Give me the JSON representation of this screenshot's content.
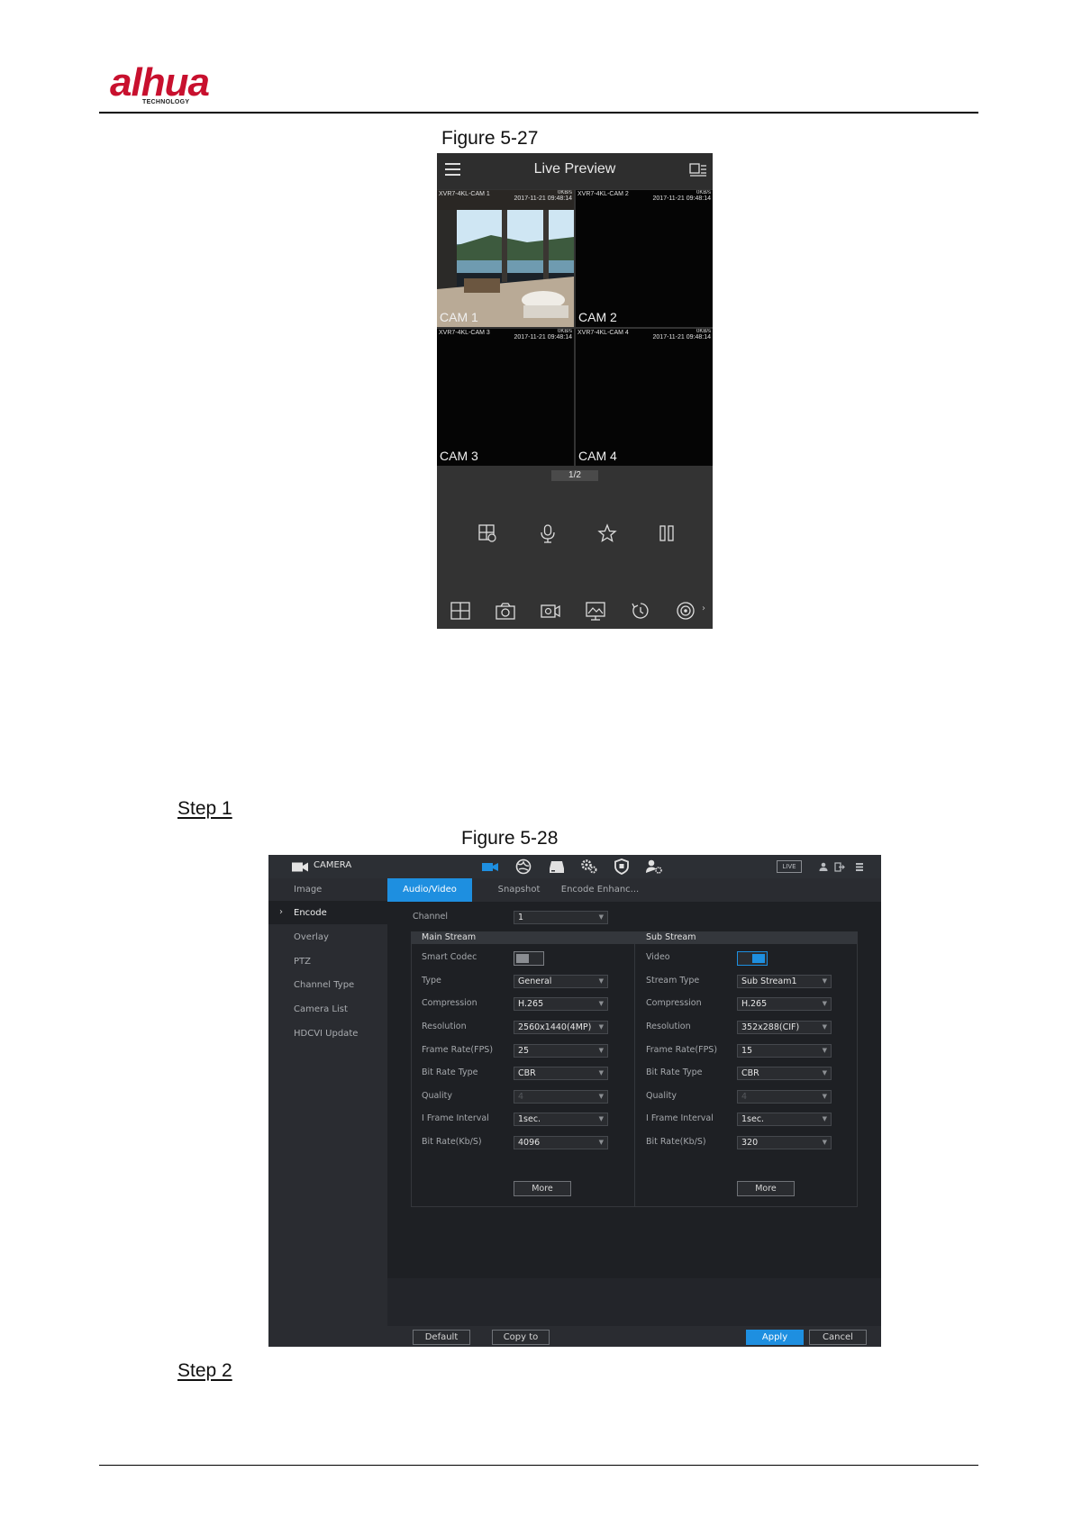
{
  "document": {
    "logo_text": "alhua",
    "logo_sub": "TECHNOLOGY",
    "figure1_caption": "Figure 5-27",
    "figure2_caption": "Figure 5-28",
    "step1": "Step 1",
    "step2": "Step 2"
  },
  "phone": {
    "title": "Live Preview",
    "page_indicator": "1/2",
    "cells": [
      {
        "osd_name": "XVR7-4KL-CAM 1",
        "osd_time": "2017-11-21 09:48:14",
        "osd_rate": "0KB/s",
        "label": "CAM 1"
      },
      {
        "osd_name": "XVR7-4KL-CAM 2",
        "osd_time": "2017-11-21 09:48:14",
        "osd_rate": "0KB/s",
        "label": "CAM 2"
      },
      {
        "osd_name": "XVR7-4KL-CAM 3",
        "osd_time": "2017-11-21 09:48:14",
        "osd_rate": "0KB/s",
        "label": "CAM 3"
      },
      {
        "osd_name": "XVR7-4KL-CAM 4",
        "osd_time": "2017-11-21 09:48:14",
        "osd_rate": "0KB/s",
        "label": "CAM 4"
      }
    ],
    "playback_tools": [
      "add-window-icon",
      "microphone-icon",
      "star-icon",
      "pause-icon"
    ],
    "bottom_tools": [
      "grid-icon",
      "snapshot-icon",
      "record-icon",
      "image-adjust-icon",
      "playback-icon",
      "ptz-icon"
    ]
  },
  "nvr": {
    "header_title": "CAMERA",
    "live_badge": "LIVE",
    "accent_color": "#1e8fe0",
    "sidebar": [
      {
        "label": "Image"
      },
      {
        "label": "Encode"
      },
      {
        "label": "Overlay"
      },
      {
        "label": "PTZ"
      },
      {
        "label": "Channel Type"
      },
      {
        "label": "Camera List"
      },
      {
        "label": "HDCVI Update"
      }
    ],
    "tabs": [
      {
        "label": "Audio/Video"
      },
      {
        "label": "Snapshot"
      },
      {
        "label": "Encode Enhanc..."
      }
    ],
    "channel_label": "Channel",
    "channel_value": "1",
    "main_stream": {
      "header": "Main Stream",
      "smart_codec_label": "Smart Codec",
      "rows": [
        {
          "label": "Type",
          "value": "General"
        },
        {
          "label": "Compression",
          "value": "H.265"
        },
        {
          "label": "Resolution",
          "value": "2560x1440(4MP)"
        },
        {
          "label": "Frame Rate(FPS)",
          "value": "25"
        },
        {
          "label": "Bit Rate Type",
          "value": "CBR"
        },
        {
          "label": "Quality",
          "value": "4"
        },
        {
          "label": "I Frame Interval",
          "value": "1sec."
        },
        {
          "label": "Bit Rate(Kb/S)",
          "value": "4096"
        }
      ],
      "more": "More"
    },
    "sub_stream": {
      "header": "Sub Stream",
      "video_label": "Video",
      "rows": [
        {
          "label": "Stream Type",
          "value": "Sub Stream1"
        },
        {
          "label": "Compression",
          "value": "H.265"
        },
        {
          "label": "Resolution",
          "value": "352x288(CIF)"
        },
        {
          "label": "Frame Rate(FPS)",
          "value": "15"
        },
        {
          "label": "Bit Rate Type",
          "value": "CBR"
        },
        {
          "label": "Quality",
          "value": "4"
        },
        {
          "label": "I Frame Interval",
          "value": "1sec."
        },
        {
          "label": "Bit Rate(Kb/S)",
          "value": "320"
        }
      ],
      "more": "More"
    },
    "buttons": {
      "default": "Default",
      "copy_to": "Copy to",
      "apply": "Apply",
      "cancel": "Cancel"
    }
  }
}
